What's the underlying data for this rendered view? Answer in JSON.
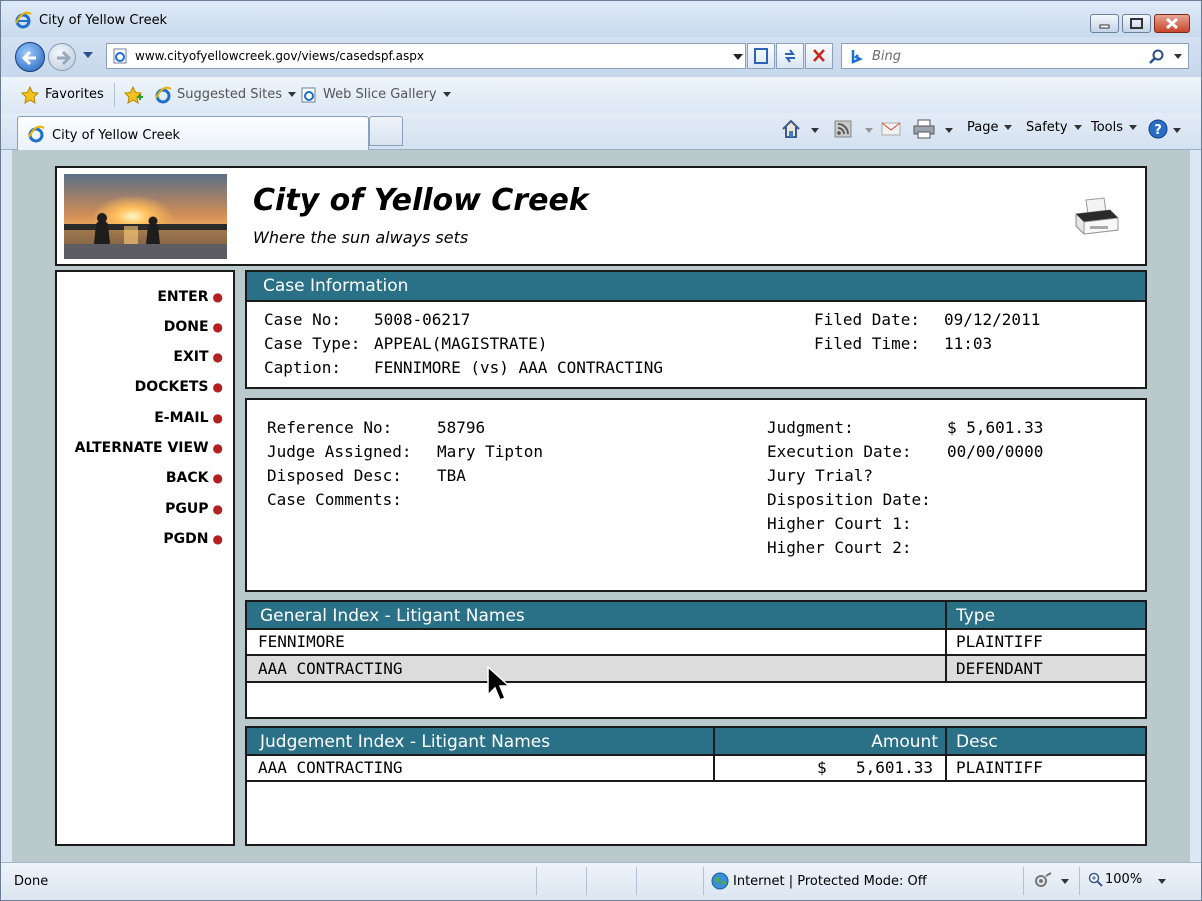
{
  "browser": {
    "window_title": "City of Yellow Creek",
    "address": "www.cityofyellowcreek.gov/views/casedspf.aspx",
    "search_placeholder": "Bing",
    "favorites_label": "Favorites",
    "suggested_sites": "Suggested Sites",
    "web_slice_gallery": "Web Slice Gallery",
    "tab_title": "City of Yellow Creek",
    "commands": {
      "page": "Page",
      "safety": "Safety",
      "tools": "Tools"
    },
    "status": "Done",
    "zone": "Internet | Protected Mode: Off",
    "zoom": "100%"
  },
  "site": {
    "title": "City of Yellow Creek",
    "tagline": "Where the sun always sets"
  },
  "menu": [
    "ENTER",
    "DONE",
    "EXIT",
    "DOCKETS",
    "E-MAIL",
    "ALTERNATE VIEW",
    "BACK",
    "PGUP",
    "PGDN"
  ],
  "case_info": {
    "heading": "Case Information",
    "case_no_label": "Case No:",
    "case_no": "5008-06217",
    "case_type_label": "Case Type:",
    "case_type": "APPEAL(MAGISTRATE)",
    "caption_label": "Caption:",
    "caption": "FENNIMORE (vs) AAA CONTRACTING",
    "filed_date_label": "Filed Date:",
    "filed_date": "09/12/2011",
    "filed_time_label": "Filed Time:",
    "filed_time": "11:03"
  },
  "details": {
    "reference_no_label": "Reference No:",
    "reference_no": "58796",
    "judge_label": "Judge Assigned:",
    "judge": "Mary Tipton",
    "disposed_label": "Disposed Desc:",
    "disposed": "TBA",
    "comments_label": "Case Comments:",
    "judgment_label": "Judgment:",
    "judgment": "$ 5,601.33",
    "execution_label": "Execution Date:",
    "execution": "00/00/0000",
    "jury_label": "Jury Trial?",
    "disposition_label": "Disposition Date:",
    "higher1_label": "Higher Court 1:",
    "higher2_label": "Higher Court 2:"
  },
  "general_index": {
    "heading": "General Index - Litigant Names",
    "type_heading": "Type",
    "rows": [
      {
        "name": "FENNIMORE",
        "type": "PLAINTIFF"
      },
      {
        "name": "AAA CONTRACTING",
        "type": "DEFENDANT"
      }
    ]
  },
  "judgement_index": {
    "heading": "Judgement Index - Litigant Names",
    "amount_heading": "Amount",
    "desc_heading": "Desc",
    "rows": [
      {
        "name": "AAA CONTRACTING",
        "currency": "$",
        "amount": "5,601.33",
        "desc": "PLAINTIFF"
      }
    ]
  },
  "colors": {
    "header_bar": "#2a7188",
    "menu_dot": "#b22020",
    "page_bg": "#b9c9cc",
    "selected_row": "#dcdcdc"
  }
}
